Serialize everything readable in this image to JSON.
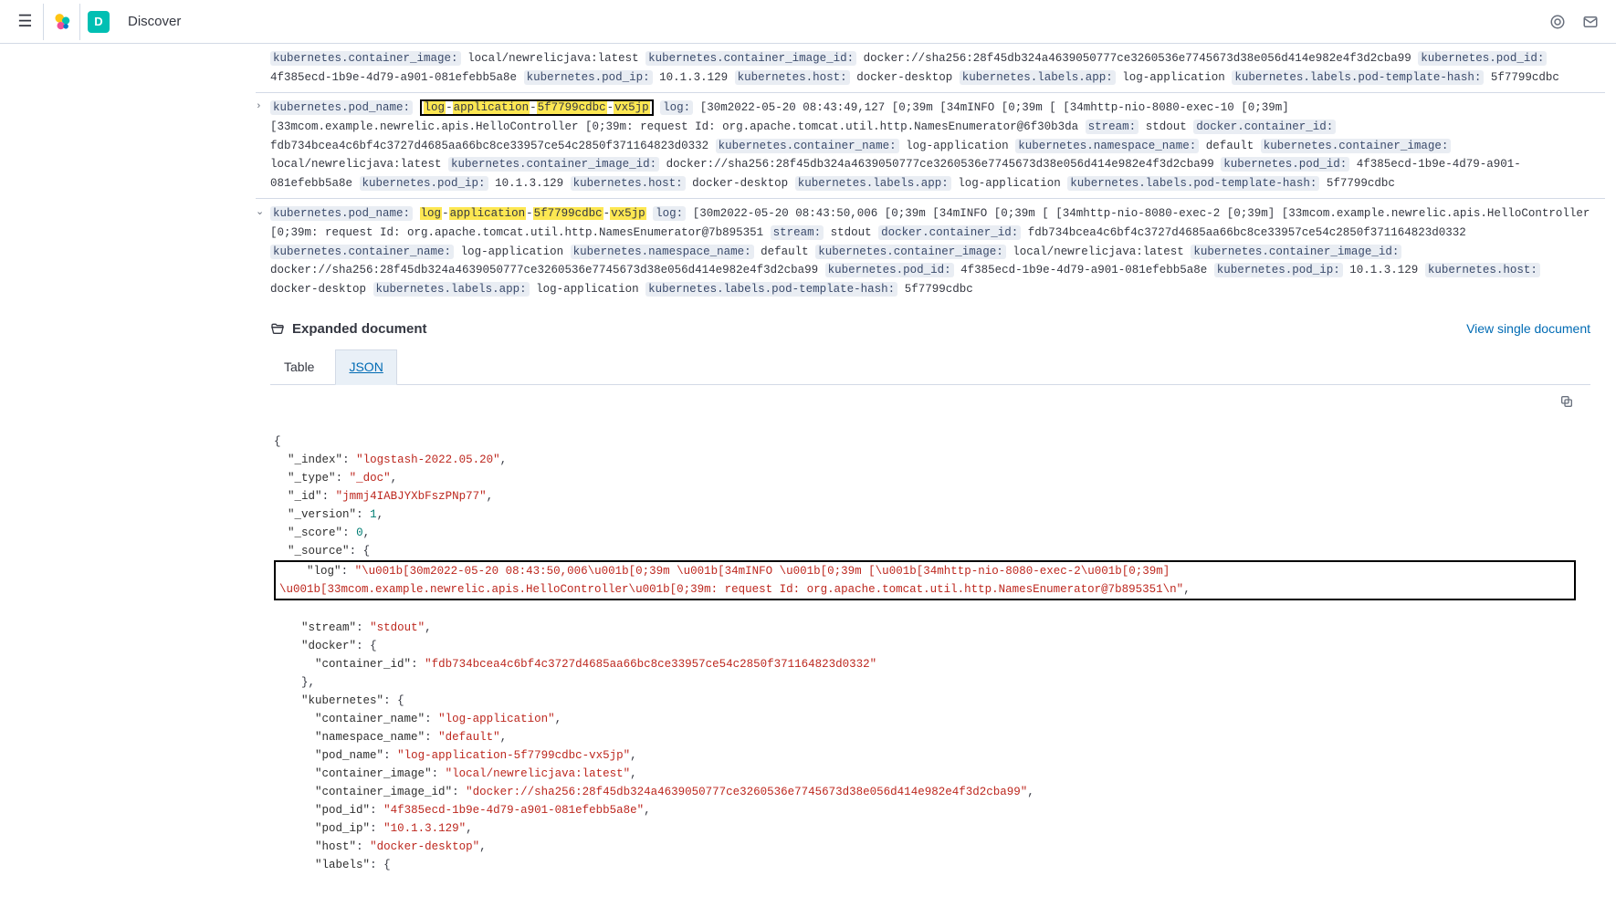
{
  "header": {
    "app_letter": "D",
    "title": "Discover"
  },
  "rows": [
    {
      "fields": [
        {
          "label": "kubernetes.container_image:",
          "value": "local/newrelicjava:latest"
        },
        {
          "label": "kubernetes.container_image_id:",
          "value": "docker://sha256:28f45db324a4639050777ce3260536e7745673d38e056d414e982e4f3d2cba99"
        },
        {
          "label": "kubernetes.pod_id:",
          "value": "4f385ecd-1b9e-4d79-a901-081efebb5a8e"
        },
        {
          "label": "kubernetes.pod_ip:",
          "value": "10.1.3.129"
        },
        {
          "label": "kubernetes.host:",
          "value": "docker-desktop"
        },
        {
          "label": "kubernetes.labels.app:",
          "value": "log-application"
        },
        {
          "label": "kubernetes.labels.pod-template-hash:",
          "value": "5f7799cdbc"
        }
      ]
    },
    {
      "expander": "›",
      "pod_name_label": "kubernetes.pod_name:",
      "pod_name_hl": [
        "log",
        "application",
        "5f7799cdbc",
        "vx5jp"
      ],
      "log_label": "log:",
      "log_value": "[30m2022-05-20 08:43:49,127 [0;39m [34mINFO [0;39m [ [34mhttp-nio-8080-exec-10 [0;39m] [33mcom.example.newrelic.apis.HelloController [0;39m: request Id: org.apache.tomcat.util.http.NamesEnumerator@6f30b3da",
      "stream_label": "stream:",
      "stream_value": "stdout",
      "docker_label": "docker.container_id:",
      "docker_value": "fdb734bcea4c6bf4c3727d4685aa66bc8ce33957ce54c2850f371164823d0332",
      "kcn_label": "kubernetes.container_name:",
      "kcn_value": "log-application",
      "kns_label": "kubernetes.namespace_name:",
      "kns_value": "default",
      "kci_label": "kubernetes.container_image:",
      "kci_value": "local/newrelicjava:latest",
      "kcii_label": "kubernetes.container_image_id:",
      "kcii_value": "docker://sha256:28f45db324a4639050777ce3260536e7745673d38e056d414e982e4f3d2cba99",
      "kpid_label": "kubernetes.pod_id:",
      "kpid_value": "4f385ecd-1b9e-4d79-a901-081efebb5a8e",
      "kpip_label": "kubernetes.pod_ip:",
      "kpip_value": "10.1.3.129",
      "kh_label": "kubernetes.host:",
      "kh_value": "docker-desktop",
      "kla_label": "kubernetes.labels.app:",
      "kla_value": "log-application",
      "klh_label": "kubernetes.labels.pod-template-hash:",
      "klh_value": "5f7799cdbc"
    },
    {
      "expander": "⌄",
      "pod_name_label": "kubernetes.pod_name:",
      "pod_name_hl": [
        "log",
        "application",
        "5f7799cdbc",
        "vx5jp"
      ],
      "log_label": "log:",
      "log_value": "[30m2022-05-20 08:43:50,006 [0;39m [34mINFO [0;39m [ [34mhttp-nio-8080-exec-2 [0;39m] [33mcom.example.newrelic.apis.HelloController [0;39m: request Id: org.apache.tomcat.util.http.NamesEnumerator@7b895351",
      "stream_label": "stream:",
      "stream_value": "stdout",
      "docker_label": "docker.container_id:",
      "docker_value": "fdb734bcea4c6bf4c3727d4685aa66bc8ce33957ce54c2850f371164823d0332",
      "kcn_label": "kubernetes.container_name:",
      "kcn_value": "log-application",
      "kns_label": "kubernetes.namespace_name:",
      "kns_value": "default",
      "kci_label": "kubernetes.container_image:",
      "kci_value": "local/newrelicjava:latest",
      "kcii_label": "kubernetes.container_image_id:",
      "kcii_value": "docker://sha256:28f45db324a4639050777ce3260536e7745673d38e056d414e982e4f3d2cba99",
      "kpid_label": "kubernetes.pod_id:",
      "kpid_value": "4f385ecd-1b9e-4d79-a901-081efebb5a8e",
      "kpip_label": "kubernetes.pod_ip:",
      "kpip_value": "10.1.3.129",
      "kh_label": "kubernetes.host:",
      "kh_value": "docker-desktop",
      "kla_label": "kubernetes.labels.app:",
      "kla_value": "log-application",
      "klh_label": "kubernetes.labels.pod-template-hash:",
      "klh_value": "5f7799cdbc"
    }
  ],
  "expanded": {
    "title": "Expanded document",
    "view_link": "View single document",
    "tabs": {
      "table": "Table",
      "json": "JSON"
    }
  },
  "json": {
    "index_k": "_index",
    "index_v": "logstash-2022.05.20",
    "type_k": "_type",
    "type_v": "_doc",
    "id_k": "_id",
    "id_v": "jmmj4IABJYXbFszPNp77",
    "version_k": "_version",
    "version_v": "1",
    "score_k": "_score",
    "score_v": "0",
    "source_k": "_source",
    "log_k": "log",
    "log_v": "\\u001b[30m2022-05-20 08:43:50,006\\u001b[0;39m \\u001b[34mINFO \\u001b[0;39m [\\u001b[34mhttp-nio-8080-exec-2\\u001b[0;39m] \\u001b[33mcom.example.newrelic.apis.HelloController\\u001b[0;39m: request Id: org.apache.tomcat.util.http.NamesEnumerator@7b895351\\n",
    "stream_k": "stream",
    "stream_v": "stdout",
    "docker_k": "docker",
    "cid_k": "container_id",
    "cid_v": "fdb734bcea4c6bf4c3727d4685aa66bc8ce33957ce54c2850f371164823d0332",
    "k8s_k": "kubernetes",
    "cn_k": "container_name",
    "cn_v": "log-application",
    "nn_k": "namespace_name",
    "nn_v": "default",
    "pn_k": "pod_name",
    "pn_v": "log-application-5f7799cdbc-vx5jp",
    "ci_k": "container_image",
    "ci_v": "local/newrelicjava:latest",
    "cii_k": "container_image_id",
    "cii_v": "docker://sha256:28f45db324a4639050777ce3260536e7745673d38e056d414e982e4f3d2cba99",
    "pid_k": "pod_id",
    "pid_v": "4f385ecd-1b9e-4d79-a901-081efebb5a8e",
    "pip_k": "pod_ip",
    "pip_v": "10.1.3.129",
    "host_k": "host",
    "host_v": "docker-desktop",
    "labels_k": "labels"
  }
}
